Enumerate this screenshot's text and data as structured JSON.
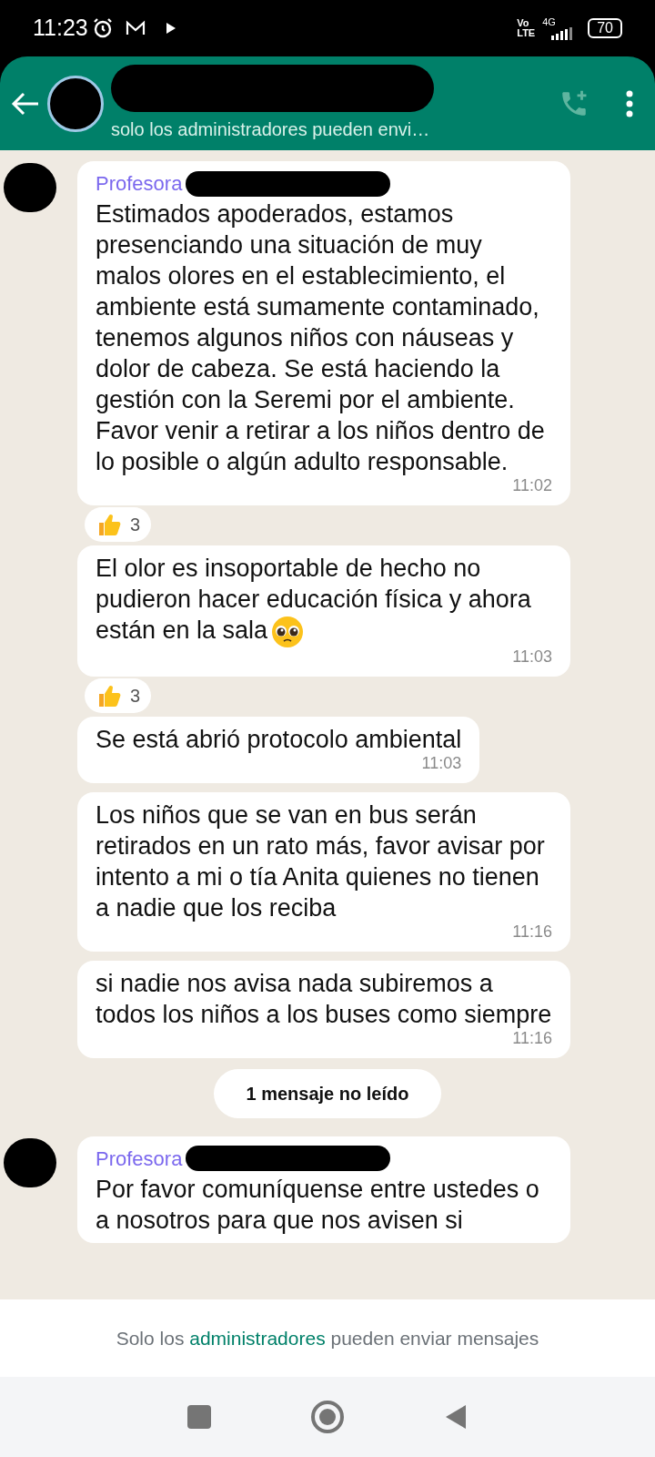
{
  "status_bar": {
    "time": "11:23",
    "volte_top": "Vo",
    "volte_bottom": "LTE",
    "network": "4G",
    "battery": "70"
  },
  "header": {
    "subtitle": "solo los administradores pueden envi…"
  },
  "messages": [
    {
      "kind": "first",
      "sender": "Profesora",
      "text": "Estimados apoderados, estamos presenciando una situación de muy malos olores en el establecimiento, el ambiente está sumamente contaminado, tenemos algunos niños con náuseas y dolor de cabeza. Se está haciendo la gestión con la Seremi por el ambiente. Favor venir a retirar a los niños dentro de lo posible o algún adulto responsable.",
      "time": "11:02",
      "reaction": "3"
    },
    {
      "kind": "follow",
      "text": "El olor es insoportable de hecho no pudieron hacer educación física y ahora están en la sala",
      "has_emoji": true,
      "time": "11:03",
      "reaction": "3"
    },
    {
      "kind": "follow",
      "text": "Se está abrió protocolo ambiental",
      "time": "11:03"
    },
    {
      "kind": "follow",
      "text": "Los niños que se van en bus serán retirados en un rato más, favor avisar por intento a mi o tía Anita quienes no tienen a nadie que los reciba",
      "time": "11:16"
    },
    {
      "kind": "follow",
      "text": "si nadie nos avisa nada subiremos a todos los niños a los buses como siempre",
      "time": "11:16"
    },
    {
      "kind": "divider",
      "text": "1 mensaje no leído"
    },
    {
      "kind": "first",
      "sender": "Profesora",
      "text": "Por favor comuníquense entre ustedes o a nosotros para que nos avisen si"
    }
  ],
  "footer": {
    "before": "Solo los",
    "link": "administradores",
    "after": "pueden enviar mensajes"
  }
}
